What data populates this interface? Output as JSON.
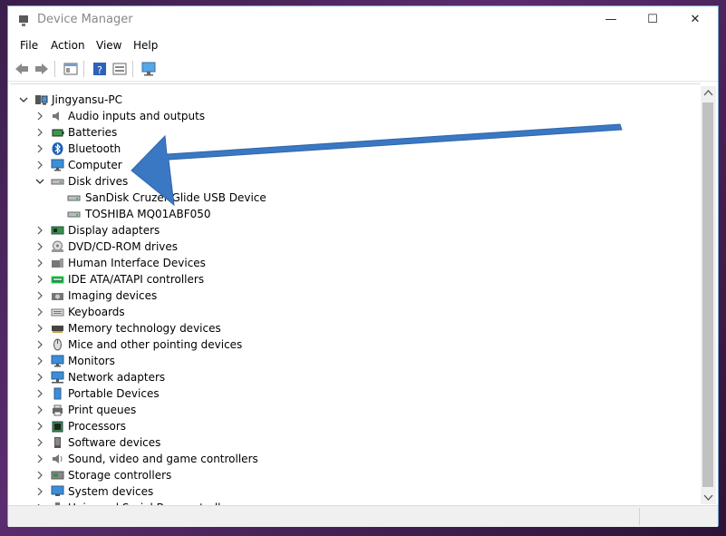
{
  "window": {
    "title": "Device Manager",
    "minimize": "—",
    "maximize": "☐",
    "close": "✕"
  },
  "menu": [
    "File",
    "Action",
    "View",
    "Help"
  ],
  "tree": {
    "root": "Jingyansu-PC",
    "categories": [
      {
        "label": "Audio inputs and outputs",
        "icon": "speaker-icon"
      },
      {
        "label": "Batteries",
        "icon": "battery-icon"
      },
      {
        "label": "Bluetooth",
        "icon": "bluetooth-icon"
      },
      {
        "label": "Computer",
        "icon": "monitor-icon"
      },
      {
        "label": "Disk drives",
        "icon": "disk-drive-icon",
        "expanded": true,
        "children": [
          "SanDisk Cruzer Glide USB Device",
          "TOSHIBA MQ01ABF050"
        ]
      },
      {
        "label": "Display adapters",
        "icon": "display-adapter-icon"
      },
      {
        "label": "DVD/CD-ROM drives",
        "icon": "dvd-icon"
      },
      {
        "label": "Human Interface Devices",
        "icon": "hid-icon"
      },
      {
        "label": "IDE ATA/ATAPI controllers",
        "icon": "ide-icon"
      },
      {
        "label": "Imaging devices",
        "icon": "camera-icon"
      },
      {
        "label": "Keyboards",
        "icon": "keyboard-icon"
      },
      {
        "label": "Memory technology devices",
        "icon": "memory-icon"
      },
      {
        "label": "Mice and other pointing devices",
        "icon": "mouse-icon"
      },
      {
        "label": "Monitors",
        "icon": "monitor-icon"
      },
      {
        "label": "Network adapters",
        "icon": "network-icon"
      },
      {
        "label": "Portable Devices",
        "icon": "portable-device-icon"
      },
      {
        "label": "Print queues",
        "icon": "printer-icon"
      },
      {
        "label": "Processors",
        "icon": "processor-icon"
      },
      {
        "label": "Software devices",
        "icon": "software-device-icon"
      },
      {
        "label": "Sound, video and game controllers",
        "icon": "sound-icon"
      },
      {
        "label": "Storage controllers",
        "icon": "storage-icon"
      },
      {
        "label": "System devices",
        "icon": "system-icon"
      },
      {
        "label": "Universal Serial Bus controllers",
        "icon": "usb-icon"
      }
    ]
  },
  "annotation": {
    "color": "#3b78c3"
  }
}
